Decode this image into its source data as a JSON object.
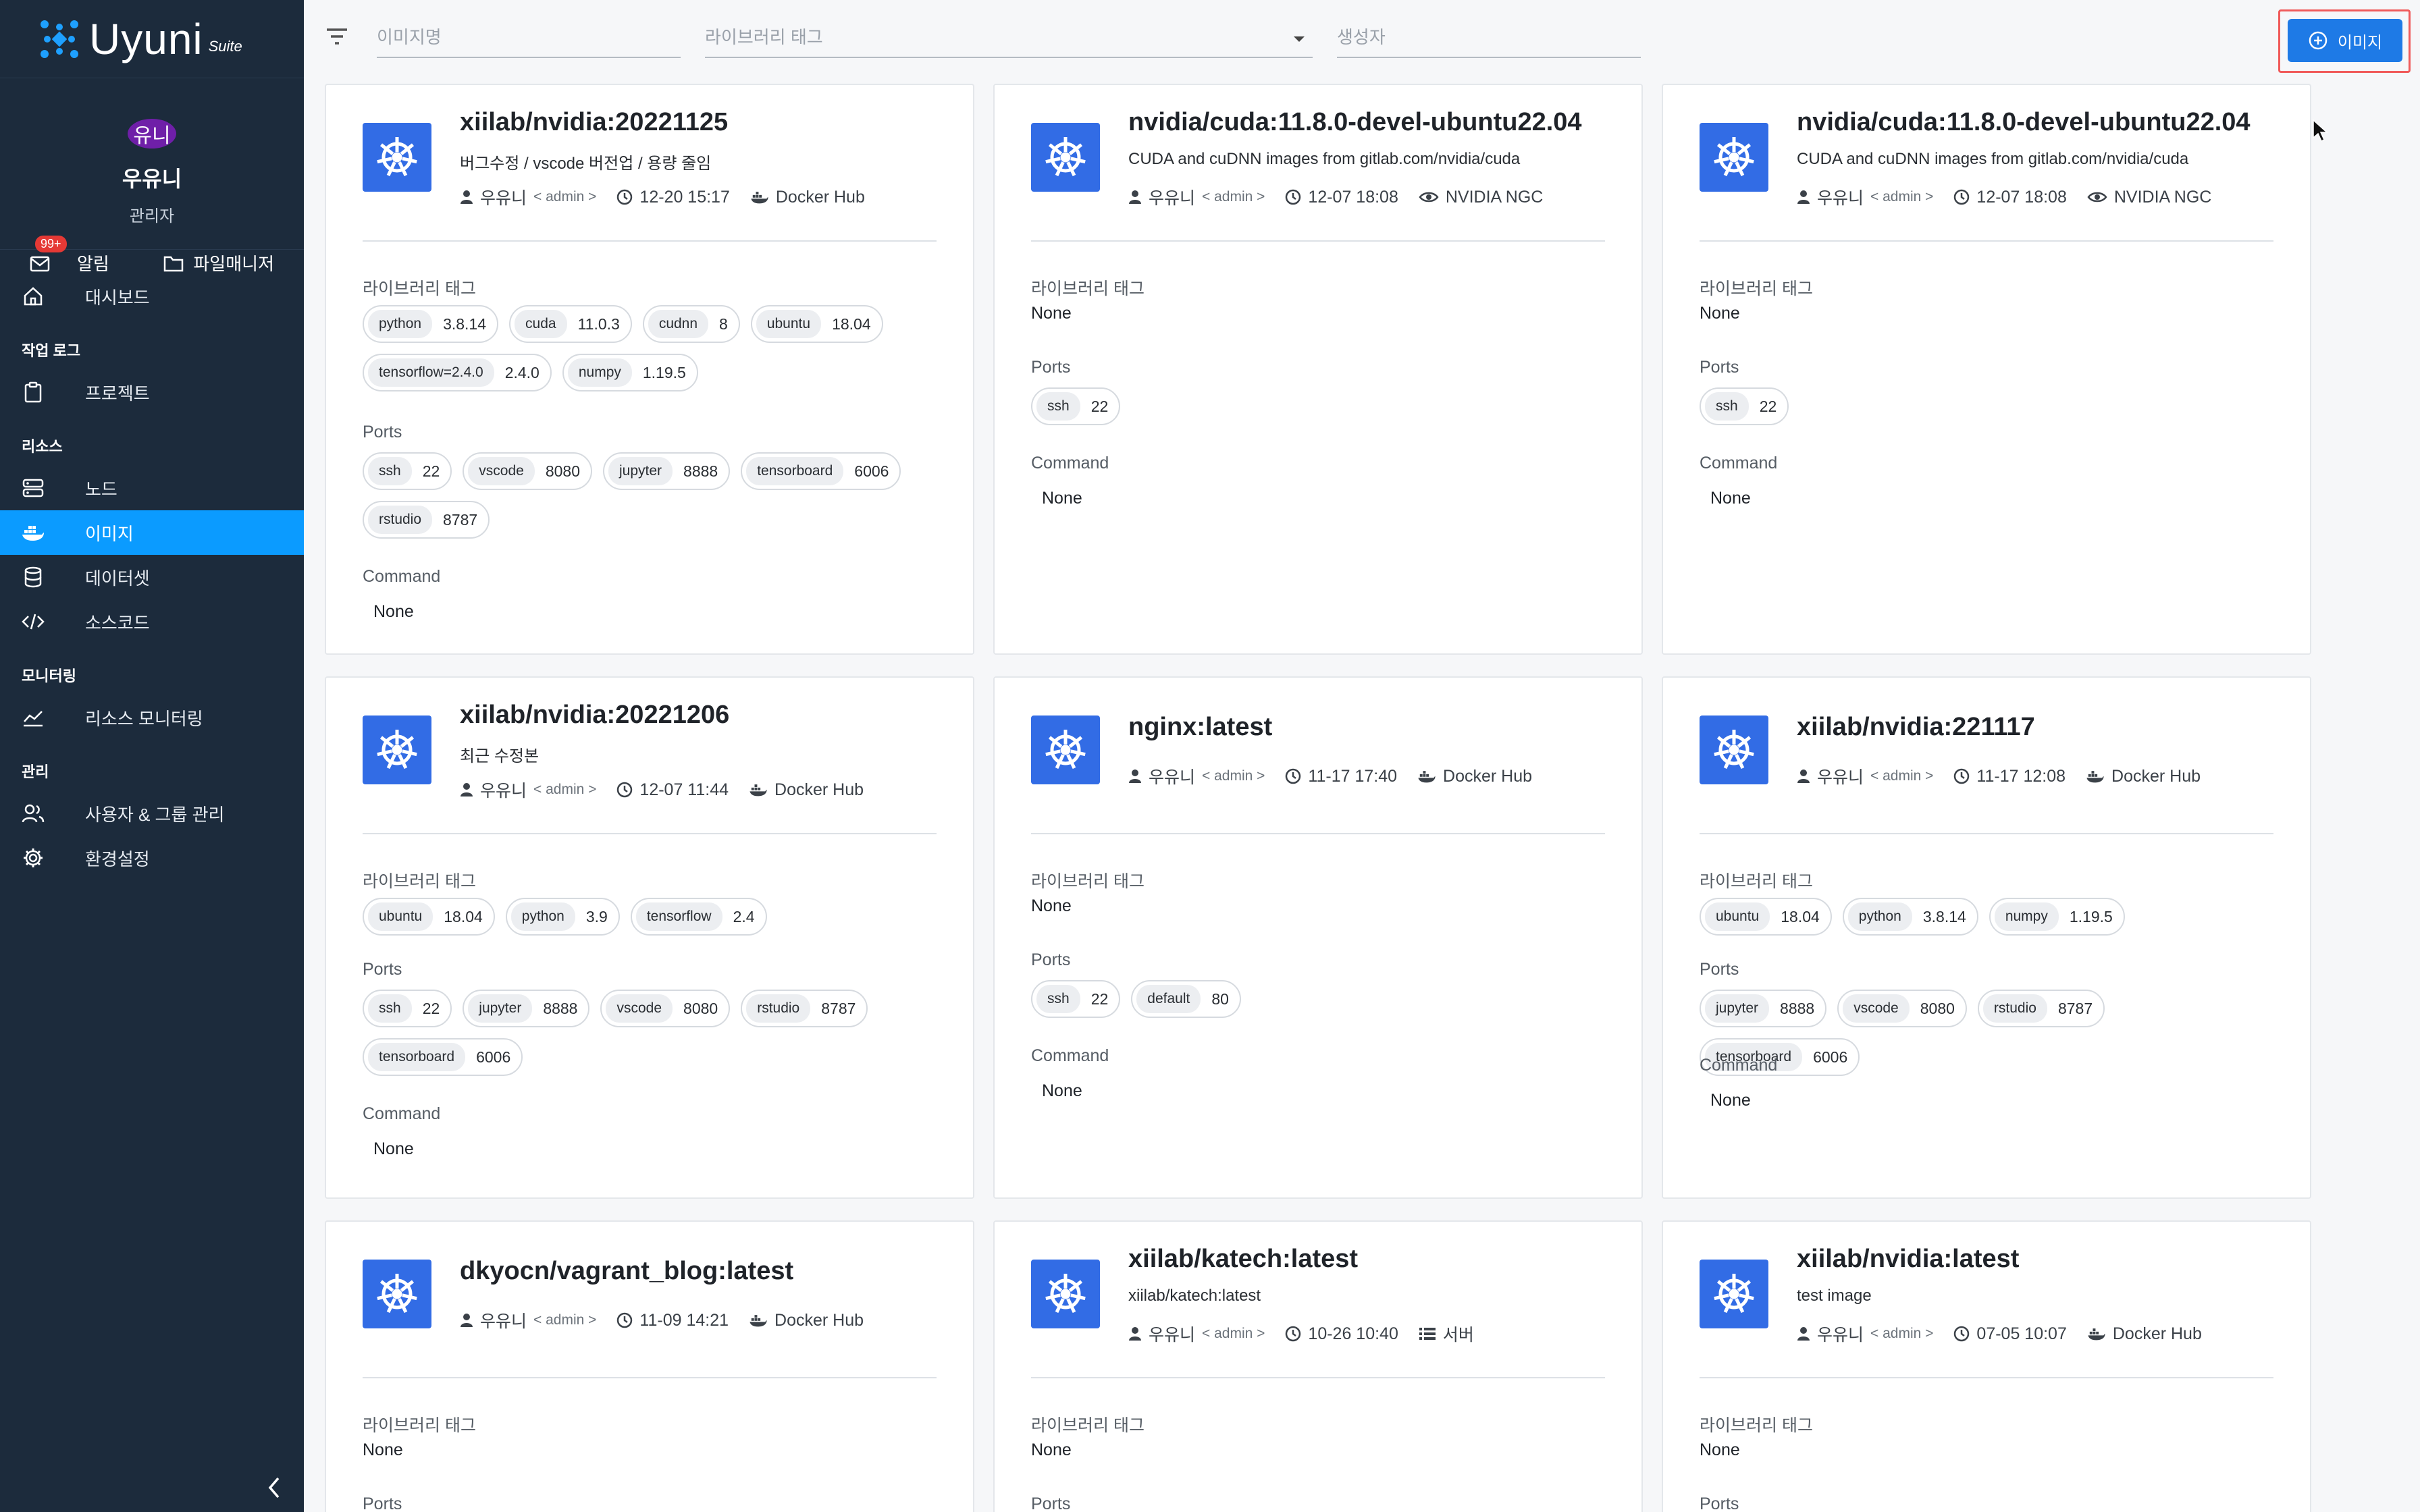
{
  "brand": {
    "name": "Uyuni",
    "suffix": "Suite"
  },
  "profile": {
    "avatar": "유니",
    "name": "우유니",
    "role": "관리자",
    "notif_label": "알림",
    "notif_badge": "99+",
    "file_label": "파일매니저"
  },
  "nav": {
    "dashboard": "대시보드",
    "sections": {
      "worklog": "작업 로그",
      "resources": "리소스",
      "monitoring": "모니터링",
      "admin": "관리"
    },
    "items": {
      "project": "프로젝트",
      "node": "노드",
      "image": "이미지",
      "dataset": "데이터셋",
      "source": "소스코드",
      "resource_monitor": "리소스 모니터링",
      "users": "사용자 & 그룹 관리",
      "settings": "환경설정"
    }
  },
  "filters": {
    "image_name_placeholder": "이미지명",
    "tag_placeholder": "라이브러리 태그",
    "creator_placeholder": "생성자"
  },
  "add_button": "이미지",
  "labels": {
    "library_tags": "라이브러리 태그",
    "ports": "Ports",
    "command": "Command",
    "none": "None",
    "admin": "< admin >"
  },
  "colors": {
    "sidebar": "#1c2b3c",
    "accent": "#0b9bff",
    "button": "#1e7ae6",
    "kube": "#326ce5"
  },
  "cards": [
    {
      "title": "xiilab/nvidia:20221125",
      "desc": "버그수정 / vscode 버전업 / 용량 줄임",
      "user": "우유니",
      "time": "12-20 15:17",
      "source": "Docker Hub",
      "tags": [
        [
          "python",
          "3.8.14"
        ],
        [
          "cuda",
          "11.0.3"
        ],
        [
          "cudnn",
          "8"
        ],
        [
          "ubuntu",
          "18.04"
        ],
        [
          "tensorflow=2.4.0",
          "2.4.0"
        ],
        [
          "numpy",
          "1.19.5"
        ]
      ],
      "ports": [
        [
          "ssh",
          "22"
        ],
        [
          "vscode",
          "8080"
        ],
        [
          "jupyter",
          "8888"
        ],
        [
          "tensorboard",
          "6006"
        ],
        [
          "rstudio",
          "8787"
        ]
      ],
      "command": "None"
    },
    {
      "title": "nvidia/cuda:11.8.0-devel-ubuntu22.04",
      "desc": "CUDA and cuDNN images from gitlab.com/nvidia/cuda",
      "user": "우유니",
      "time": "12-07 18:08",
      "source": "NVIDIA NGC",
      "tags": [],
      "ports": [
        [
          "ssh",
          "22"
        ]
      ],
      "command": "None"
    },
    {
      "title": "nvidia/cuda:11.8.0-devel-ubuntu22.04",
      "desc": "CUDA and cuDNN images from gitlab.com/nvidia/cuda",
      "user": "우유니",
      "time": "12-07 18:08",
      "source": "NVIDIA NGC",
      "tags": [],
      "ports": [
        [
          "ssh",
          "22"
        ]
      ],
      "command": "None"
    },
    {
      "title": "xiilab/nvidia:20221206",
      "desc": "최근 수정본",
      "user": "우유니",
      "time": "12-07 11:44",
      "source": "Docker Hub",
      "tags": [
        [
          "ubuntu",
          "18.04"
        ],
        [
          "python",
          "3.9"
        ],
        [
          "tensorflow",
          "2.4"
        ]
      ],
      "ports": [
        [
          "ssh",
          "22"
        ],
        [
          "jupyter",
          "8888"
        ],
        [
          "vscode",
          "8080"
        ],
        [
          "rstudio",
          "8787"
        ],
        [
          "tensorboard",
          "6006"
        ]
      ],
      "command": "None"
    },
    {
      "title": "nginx:latest",
      "desc": "",
      "user": "우유니",
      "time": "11-17 17:40",
      "source": "Docker Hub",
      "tags": [],
      "ports": [
        [
          "ssh",
          "22"
        ],
        [
          "default",
          "80"
        ]
      ],
      "command": "None"
    },
    {
      "title": "xiilab/nvidia:221117",
      "desc": "",
      "user": "우유니",
      "time": "11-17 12:08",
      "source": "Docker Hub",
      "tags": [
        [
          "ubuntu",
          "18.04"
        ],
        [
          "python",
          "3.8.14"
        ],
        [
          "numpy",
          "1.19.5"
        ]
      ],
      "ports": [
        [
          "jupyter",
          "8888"
        ],
        [
          "vscode",
          "8080"
        ],
        [
          "rstudio",
          "8787"
        ],
        [
          "tensorboard",
          "6006"
        ]
      ],
      "command": "None"
    },
    {
      "title": "dkyocn/vagrant_blog:latest",
      "desc": "",
      "user": "우유니",
      "time": "11-09 14:21",
      "source": "Docker Hub",
      "tags": [],
      "ports": [],
      "command": ""
    },
    {
      "title": "xiilab/katech:latest",
      "desc": "xiilab/katech:latest",
      "user": "우유니",
      "time": "10-26 10:40",
      "source": "서버",
      "tags": [],
      "ports": [],
      "command": ""
    },
    {
      "title": "xiilab/nvidia:latest",
      "desc": "test image",
      "user": "우유니",
      "time": "07-05 10:07",
      "source": "Docker Hub",
      "tags": [],
      "ports": [],
      "command": ""
    }
  ]
}
